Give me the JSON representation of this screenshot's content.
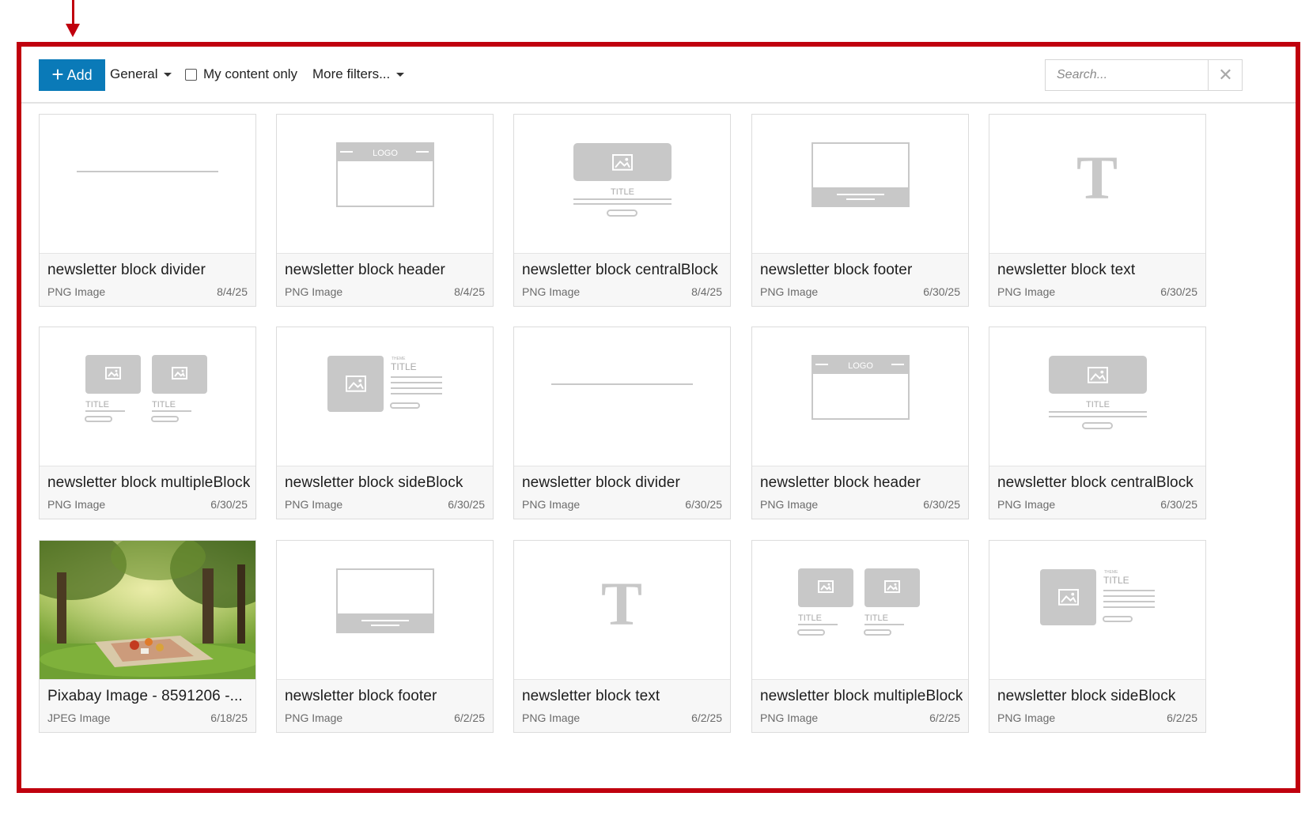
{
  "toolbar": {
    "add_label": "Add",
    "category_label": "General",
    "my_content_label": "My content only",
    "more_filters_label": "More filters...",
    "search_placeholder": "Search...",
    "search_value": ""
  },
  "thumbnail_text": {
    "logo": "LOGO",
    "title": "TITLE",
    "theme": "THEME",
    "text_glyph": "T"
  },
  "cards": [
    {
      "title": "newsletter block divider",
      "type": "PNG Image",
      "date": "8/4/25",
      "thumb": "divider"
    },
    {
      "title": "newsletter block header",
      "type": "PNG Image",
      "date": "8/4/25",
      "thumb": "header"
    },
    {
      "title": "newsletter block centralBlock",
      "type": "PNG Image",
      "date": "8/4/25",
      "thumb": "central"
    },
    {
      "title": "newsletter block footer",
      "type": "PNG Image",
      "date": "6/30/25",
      "thumb": "footer"
    },
    {
      "title": "newsletter block text",
      "type": "PNG Image",
      "date": "6/30/25",
      "thumb": "text"
    },
    {
      "title": "newsletter block multipleBlock",
      "type": "PNG Image",
      "date": "6/30/25",
      "thumb": "multiple"
    },
    {
      "title": "newsletter block sideBlock",
      "type": "PNG Image",
      "date": "6/30/25",
      "thumb": "side"
    },
    {
      "title": "newsletter block divider",
      "type": "PNG Image",
      "date": "6/30/25",
      "thumb": "divider"
    },
    {
      "title": "newsletter block header",
      "type": "PNG Image",
      "date": "6/30/25",
      "thumb": "header"
    },
    {
      "title": "newsletter block centralBlock",
      "type": "PNG Image",
      "date": "6/30/25",
      "thumb": "central"
    },
    {
      "title": "Pixabay Image - 8591206 -...",
      "type": "JPEG Image",
      "date": "6/18/25",
      "thumb": "photo"
    },
    {
      "title": "newsletter block footer",
      "type": "PNG Image",
      "date": "6/2/25",
      "thumb": "footer"
    },
    {
      "title": "newsletter block text",
      "type": "PNG Image",
      "date": "6/2/25",
      "thumb": "text"
    },
    {
      "title": "newsletter block multipleBlock",
      "type": "PNG Image",
      "date": "6/2/25",
      "thumb": "multiple"
    },
    {
      "title": "newsletter block sideBlock",
      "type": "PNG Image",
      "date": "6/2/25",
      "thumb": "side"
    }
  ],
  "colors": {
    "frame_highlight": "#c0000e",
    "add_button": "#0a7ab8",
    "placeholder_gray": "#c8c8c8"
  }
}
